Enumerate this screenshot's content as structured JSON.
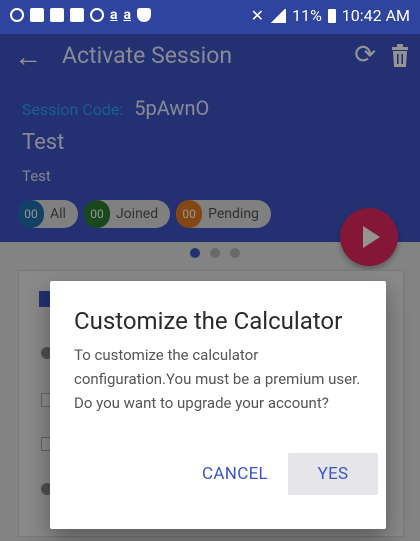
{
  "status_bar": {
    "left_icons": [
      "notification-icon",
      "alert-icon",
      "message-icon",
      "photo-icon",
      "voicemail-icon"
    ],
    "letters": [
      "a",
      "a"
    ],
    "right_text": "11%",
    "time": "10:42 AM"
  },
  "app_bar": {
    "title": "Activate Session",
    "back_icon": "←",
    "refresh_icon": "⟳"
  },
  "session": {
    "code_label": "Session Code:",
    "code_value": "5pAwnO",
    "name": "Test",
    "description": "Test"
  },
  "chips": [
    {
      "count": "00",
      "label": "All",
      "color": "#1f6fb2"
    },
    {
      "count": "00",
      "label": "Joined",
      "color": "#2e7d32"
    },
    {
      "count": "00",
      "label": "Pending",
      "color": "#e07a1f"
    }
  ],
  "colors": {
    "primary": "#3d55c6",
    "status_bar": "#2f449f",
    "fab": "#e3275f",
    "session_code_label": "#2aa0f5"
  },
  "pager": {
    "pages": 3,
    "active": 1
  },
  "dialog": {
    "title": "Customize the Calculator",
    "message": "To customize the calculator configuration.You must be a premium user. Do you want to upgrade your account?",
    "cancel_label": "CANCEL",
    "yes_label": "YES"
  }
}
